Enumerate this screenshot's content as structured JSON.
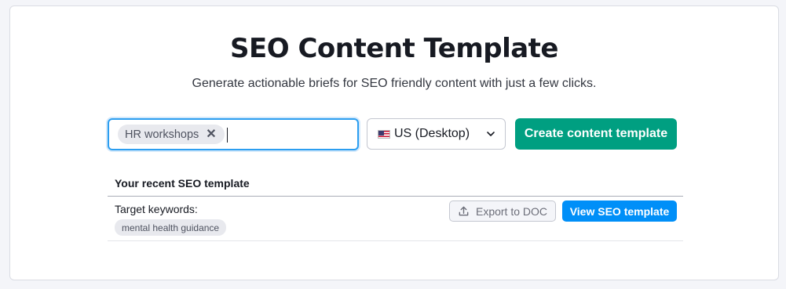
{
  "header": {
    "title": "SEO Content Template",
    "subtitle": "Generate actionable briefs for SEO friendly content with just a few clicks."
  },
  "keyword_input": {
    "chips": [
      {
        "label": "HR workshops",
        "remove_icon": "close-icon"
      }
    ],
    "value": ""
  },
  "database_select": {
    "flag_icon": "us-flag-icon",
    "selected": "US (Desktop)",
    "chevron_icon": "chevron-down-icon"
  },
  "actions": {
    "create_label": "Create content template"
  },
  "recent": {
    "heading": "Your recent SEO template",
    "rows": [
      {
        "label": "Target keywords:",
        "keywords": [
          "mental health guidance"
        ],
        "export_label": "Export to DOC",
        "export_icon": "upload-icon",
        "view_label": "View SEO template"
      }
    ]
  },
  "colors": {
    "primary_green": "#009f81",
    "primary_blue": "#008ff8",
    "focus_border": "#2c9ef0",
    "page_background": "#f4f5f9"
  }
}
